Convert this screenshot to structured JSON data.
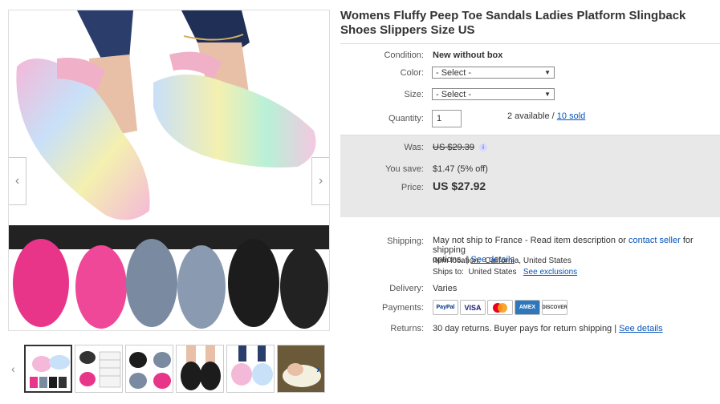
{
  "listing": {
    "title": "Womens Fluffy Peep Toe Sandals Ladies Platform Slingback Shoes Slippers Size US"
  },
  "gallery": {
    "thumb_count": 6,
    "colors": {
      "rainbow_pink": "#f4b8d8",
      "rainbow_blue": "#b8d8f4",
      "rainbow_yellow": "#f4f0b0",
      "hot_pink": "#e8358a",
      "grey_blue": "#7a8aa0",
      "black": "#1c1c1c",
      "strap_pink": "#f0b0c8"
    }
  },
  "details": {
    "condition_label": "Condition:",
    "condition_value": "New without box",
    "color_label": "Color:",
    "color_select": "- Select -",
    "size_label": "Size:",
    "size_select": "- Select -",
    "quantity_label": "Quantity:",
    "quantity_value": "1",
    "available_text": "2 available /",
    "sold_link": "10 sold"
  },
  "price": {
    "was_label": "Was:",
    "was_value": "US $29.39",
    "save_label": "You save:",
    "save_value": "$1.47 (5% off)",
    "price_label": "Price:",
    "price_value": "US $27.92"
  },
  "shipping": {
    "label": "Shipping:",
    "line1": "May not ship to France - Read item description or",
    "contact_link": "contact seller",
    "line1_end": "for shipping",
    "line2": "options. |",
    "see_details": "See details",
    "location_label": "Item location:",
    "location_value": "California, United States",
    "ships_label": "Ships to:",
    "ships_value": "United States",
    "see_exclusions": "See exclusions"
  },
  "delivery": {
    "label": "Delivery:",
    "value": "Varies"
  },
  "payments": {
    "label": "Payments:",
    "methods": [
      "PayPal",
      "VISA",
      "MasterCard",
      "AMEX",
      "DISCOVER"
    ]
  },
  "returns": {
    "label": "Returns:",
    "value": "30 day returns. Buyer pays for return shipping |",
    "see_details": "See details"
  }
}
